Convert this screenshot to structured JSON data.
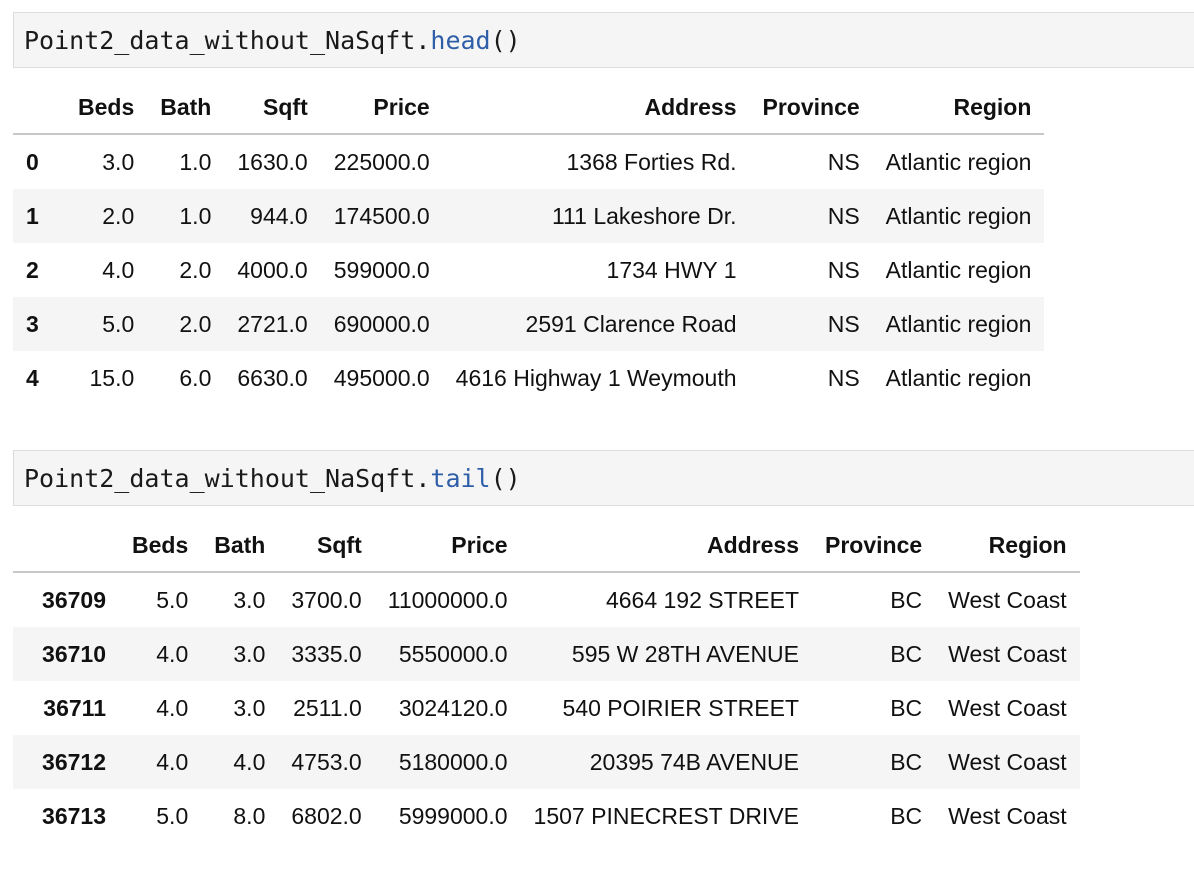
{
  "cells": [
    {
      "code": {
        "object": "Point2_data_without_NaSqft",
        "dot": ".",
        "method": "head",
        "call": "()"
      },
      "table": {
        "columns": [
          "",
          "Beds",
          "Bath",
          "Sqft",
          "Price",
          "Address",
          "Province",
          "Region"
        ],
        "rows": [
          {
            "index": "0",
            "beds": "3.0",
            "bath": "1.0",
            "sqft": "1630.0",
            "price": "225000.0",
            "address": "1368 Forties Rd.",
            "province": "NS",
            "region": "Atlantic region"
          },
          {
            "index": "1",
            "beds": "2.0",
            "bath": "1.0",
            "sqft": "944.0",
            "price": "174500.0",
            "address": "111 Lakeshore Dr.",
            "province": "NS",
            "region": "Atlantic region"
          },
          {
            "index": "2",
            "beds": "4.0",
            "bath": "2.0",
            "sqft": "4000.0",
            "price": "599000.0",
            "address": "1734 HWY 1",
            "province": "NS",
            "region": "Atlantic region"
          },
          {
            "index": "3",
            "beds": "5.0",
            "bath": "2.0",
            "sqft": "2721.0",
            "price": "690000.0",
            "address": "2591 Clarence Road",
            "province": "NS",
            "region": "Atlantic region"
          },
          {
            "index": "4",
            "beds": "15.0",
            "bath": "6.0",
            "sqft": "6630.0",
            "price": "495000.0",
            "address": "4616 Highway 1 Weymouth",
            "province": "NS",
            "region": "Atlantic region"
          }
        ]
      }
    },
    {
      "code": {
        "object": "Point2_data_without_NaSqft",
        "dot": ".",
        "method": "tail",
        "call": "()"
      },
      "table": {
        "columns": [
          "",
          "Beds",
          "Bath",
          "Sqft",
          "Price",
          "Address",
          "Province",
          "Region"
        ],
        "rows": [
          {
            "index": "36709",
            "beds": "5.0",
            "bath": "3.0",
            "sqft": "3700.0",
            "price": "11000000.0",
            "address": "4664 192 STREET",
            "province": "BC",
            "region": "West Coast"
          },
          {
            "index": "36710",
            "beds": "4.0",
            "bath": "3.0",
            "sqft": "3335.0",
            "price": "5550000.0",
            "address": "595 W 28TH AVENUE",
            "province": "BC",
            "region": "West Coast"
          },
          {
            "index": "36711",
            "beds": "4.0",
            "bath": "3.0",
            "sqft": "2511.0",
            "price": "3024120.0",
            "address": "540 POIRIER STREET",
            "province": "BC",
            "region": "West Coast"
          },
          {
            "index": "36712",
            "beds": "4.0",
            "bath": "4.0",
            "sqft": "4753.0",
            "price": "5180000.0",
            "address": "20395 74B AVENUE",
            "province": "BC",
            "region": "West Coast"
          },
          {
            "index": "36713",
            "beds": "5.0",
            "bath": "8.0",
            "sqft": "6802.0",
            "price": "5999000.0",
            "address": "1507 PINECREST DRIVE",
            "province": "BC",
            "region": "West Coast"
          }
        ]
      }
    }
  ]
}
